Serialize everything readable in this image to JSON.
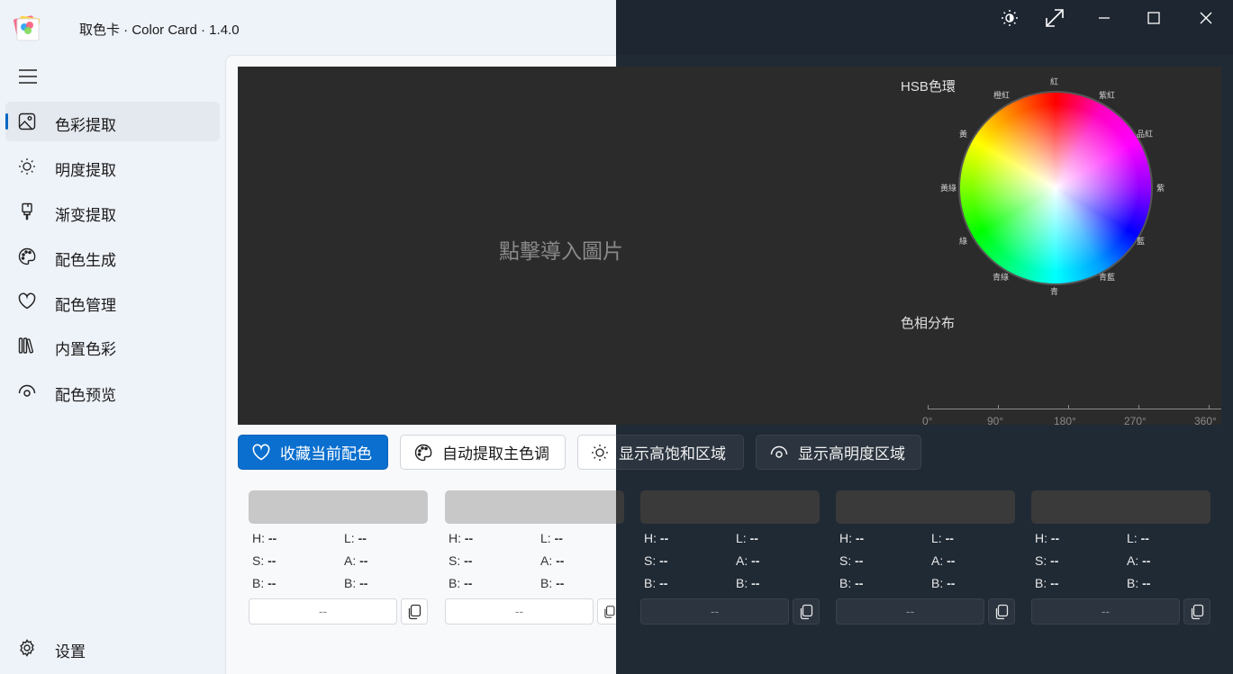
{
  "app": {
    "title": "取色卡 · Color Card · 1.4.0",
    "logo_text": "Color Card"
  },
  "window_controls": [
    "theme-icon",
    "expand-icon",
    "minimize-icon",
    "maximize-icon",
    "close-icon"
  ],
  "sidebar": {
    "items": [
      {
        "label": "色彩提取",
        "icon": "image-icon",
        "active": true
      },
      {
        "label": "明度提取",
        "icon": "sun-icon"
      },
      {
        "label": "渐变提取",
        "icon": "brush-icon"
      },
      {
        "label": "配色生成",
        "icon": "palette-icon"
      },
      {
        "label": "配色管理",
        "icon": "heart-icon"
      },
      {
        "label": "内置色彩",
        "icon": "library-icon"
      },
      {
        "label": "配色预览",
        "icon": "eye-icon"
      }
    ],
    "settings_label": "设置"
  },
  "drop_area": {
    "placeholder": "點擊導入圖片"
  },
  "hsb_wheel": {
    "title": "HSB色環",
    "labels": [
      "紅",
      "紫紅",
      "品紅",
      "紫",
      "藍",
      "青藍",
      "青",
      "青綠",
      "綠",
      "黃綠",
      "黃",
      "橙紅"
    ]
  },
  "hue_distribution": {
    "title": "色相分布",
    "ticks": [
      "0°",
      "90°",
      "180°",
      "270°",
      "360°"
    ]
  },
  "actions": {
    "favorite": "收藏当前配色",
    "auto_extract": "自动提取主色调",
    "show_saturation": "显示高饱和区域",
    "show_brightness": "显示高明度区域"
  },
  "colors": {
    "accent": "#0a6fcf",
    "light_swatch": "#c8c8c8",
    "dark_swatch": "#3a3a3a"
  },
  "cards": [
    {
      "h": "H: ",
      "s": "S: ",
      "b": "B: ",
      "l": "L: ",
      "a": "A: ",
      "bb": "B: ",
      "hv": "--",
      "sv": "--",
      "bv": "--",
      "lv": "--",
      "av": "--",
      "bbv": "--",
      "hex": "--"
    },
    {
      "h": "H: ",
      "s": "S: ",
      "b": "B: ",
      "l": "L: ",
      "a": "A: ",
      "bb": "B: ",
      "hv": "--",
      "sv": "--",
      "bv": "--",
      "lv": "--",
      "av": "--",
      "bbv": "--",
      "hex": "--"
    },
    {
      "h": "H: ",
      "s": "S: ",
      "b": "B: ",
      "l": "L: ",
      "a": "A: ",
      "bb": "B: ",
      "hv": "--",
      "sv": "--",
      "bv": "--",
      "lv": "--",
      "av": "--",
      "bbv": "--",
      "hex": "--"
    },
    {
      "h": "H: ",
      "s": "S: ",
      "b": "B: ",
      "l": "L: ",
      "a": "A: ",
      "bb": "B: ",
      "hv": "--",
      "sv": "--",
      "bv": "--",
      "lv": "--",
      "av": "--",
      "bbv": "--",
      "hex": "--"
    },
    {
      "h": "H: ",
      "s": "S: ",
      "b": "B: ",
      "l": "L: ",
      "a": "A: ",
      "bb": "B: ",
      "hv": "--",
      "sv": "--",
      "bv": "--",
      "lv": "--",
      "av": "--",
      "bbv": "--",
      "hex": "--"
    }
  ]
}
